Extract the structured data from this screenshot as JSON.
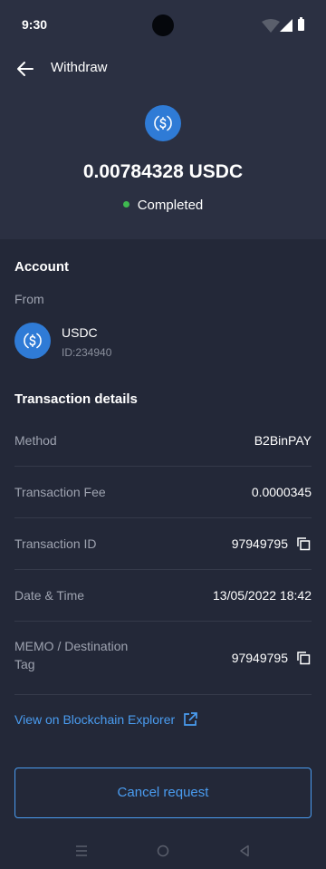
{
  "status_bar": {
    "time": "9:30"
  },
  "header": {
    "title": "Withdraw",
    "amount": "0.00784328 USDC",
    "status": "Completed"
  },
  "account": {
    "section_title": "Account",
    "from_label": "From",
    "name": "USDC",
    "id": "ID:234940"
  },
  "details": {
    "section_title": "Transaction details",
    "method": {
      "label": "Method",
      "value": "B2BinPAY"
    },
    "fee": {
      "label": "Transaction Fee",
      "value": "0.0000345"
    },
    "transaction_id": {
      "label": "Transaction ID",
      "value": "97949795"
    },
    "date_time": {
      "label": "Date & Time",
      "value": "13/05/2022 18:42"
    },
    "memo": {
      "label_line1": "MEMO / Destination",
      "label_line2": "Tag",
      "value": "97949795"
    }
  },
  "explorer_link": "View on Blockchain Explorer",
  "cancel_button": "Cancel request",
  "colors": {
    "accent": "#4a9cf0",
    "coin": "#2f7bd6",
    "success": "#3fb950",
    "background": "#232838",
    "header_background": "#2b3042"
  }
}
